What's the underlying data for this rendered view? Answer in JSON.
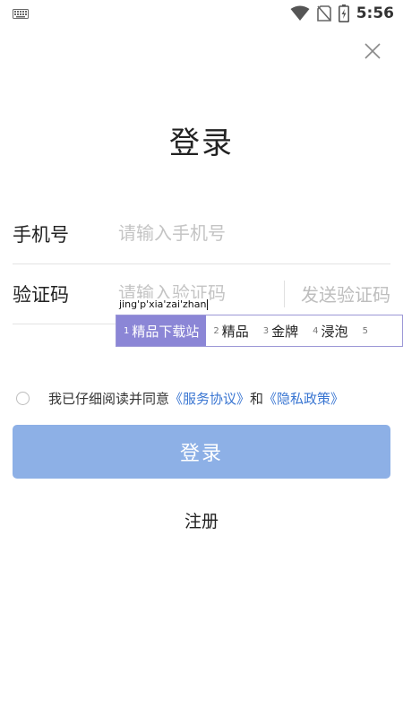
{
  "status_bar": {
    "time": "5:56",
    "icons": [
      "keyboard-icon",
      "wifi-icon",
      "no-sim-icon",
      "battery-charging-icon"
    ]
  },
  "header": {
    "close_icon": "close-icon",
    "title": "登录"
  },
  "form": {
    "phone": {
      "label": "手机号",
      "placeholder": "请输入手机号",
      "value": ""
    },
    "code": {
      "label": "验证码",
      "placeholder": "请输入验证码",
      "value": "",
      "send_label": "发送验证码"
    }
  },
  "ime": {
    "composition": "jing'p'xia'zai'zhan",
    "candidates": [
      {
        "num": "1",
        "text": "精品下载站"
      },
      {
        "num": "2",
        "text": "精品"
      },
      {
        "num": "3",
        "text": "金牌"
      },
      {
        "num": "4",
        "text": "浸泡"
      },
      {
        "num": "5",
        "text": ""
      }
    ]
  },
  "agreement": {
    "prefix": "我已仔细阅读并同意",
    "service_link": "《服务协议》",
    "conjunction": "和",
    "privacy_link": "《隐私政策》"
  },
  "actions": {
    "login_label": "登录",
    "register_label": "注册"
  },
  "colors": {
    "login_button": "#8db0e6",
    "link": "#3a76d2",
    "ime_active": "#8b86d6"
  }
}
